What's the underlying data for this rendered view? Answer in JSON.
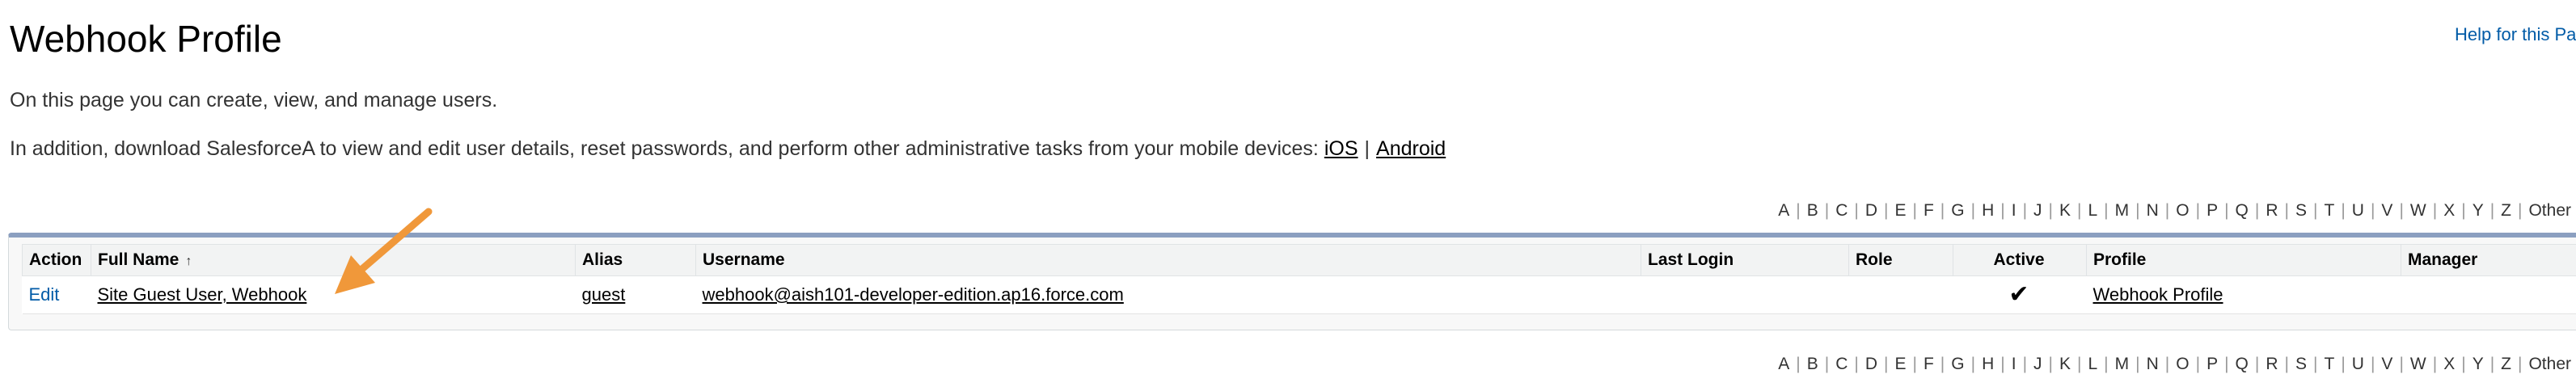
{
  "page": {
    "title": "Webhook Profile",
    "help_link": "Help for this Page",
    "description": "On this page you can create, view, and manage users.",
    "mobile_text": "In addition, download SalesforceA to view and edit user details, reset passwords, and perform other administrative tasks from your mobile devices:",
    "mobile_links": [
      "iOS",
      "Android"
    ],
    "mobile_separator": "|"
  },
  "alphabet": [
    "A",
    "B",
    "C",
    "D",
    "E",
    "F",
    "G",
    "H",
    "I",
    "J",
    "K",
    "L",
    "M",
    "N",
    "O",
    "P",
    "Q",
    "R",
    "S",
    "T",
    "U",
    "V",
    "W",
    "X",
    "Y",
    "Z",
    "Other"
  ],
  "table": {
    "columns": [
      "Action",
      "Full Name",
      "Alias",
      "Username",
      "Last Login",
      "Role",
      "Active",
      "Profile",
      "Manager"
    ],
    "sort_indicator": "↑",
    "rows": [
      {
        "action": "Edit",
        "full_name": "Site Guest User, Webhook",
        "alias": "guest",
        "username": "webhook@aish101-developer-edition.ap16.force.com",
        "last_login": "",
        "role": "",
        "active": true,
        "active_mark": "✔",
        "profile": "Webhook Profile",
        "manager": ""
      }
    ]
  },
  "colors": {
    "link_blue": "#015ba7",
    "table_border_accent": "#8b9fc0",
    "annotation_arrow": "#f0983a"
  }
}
